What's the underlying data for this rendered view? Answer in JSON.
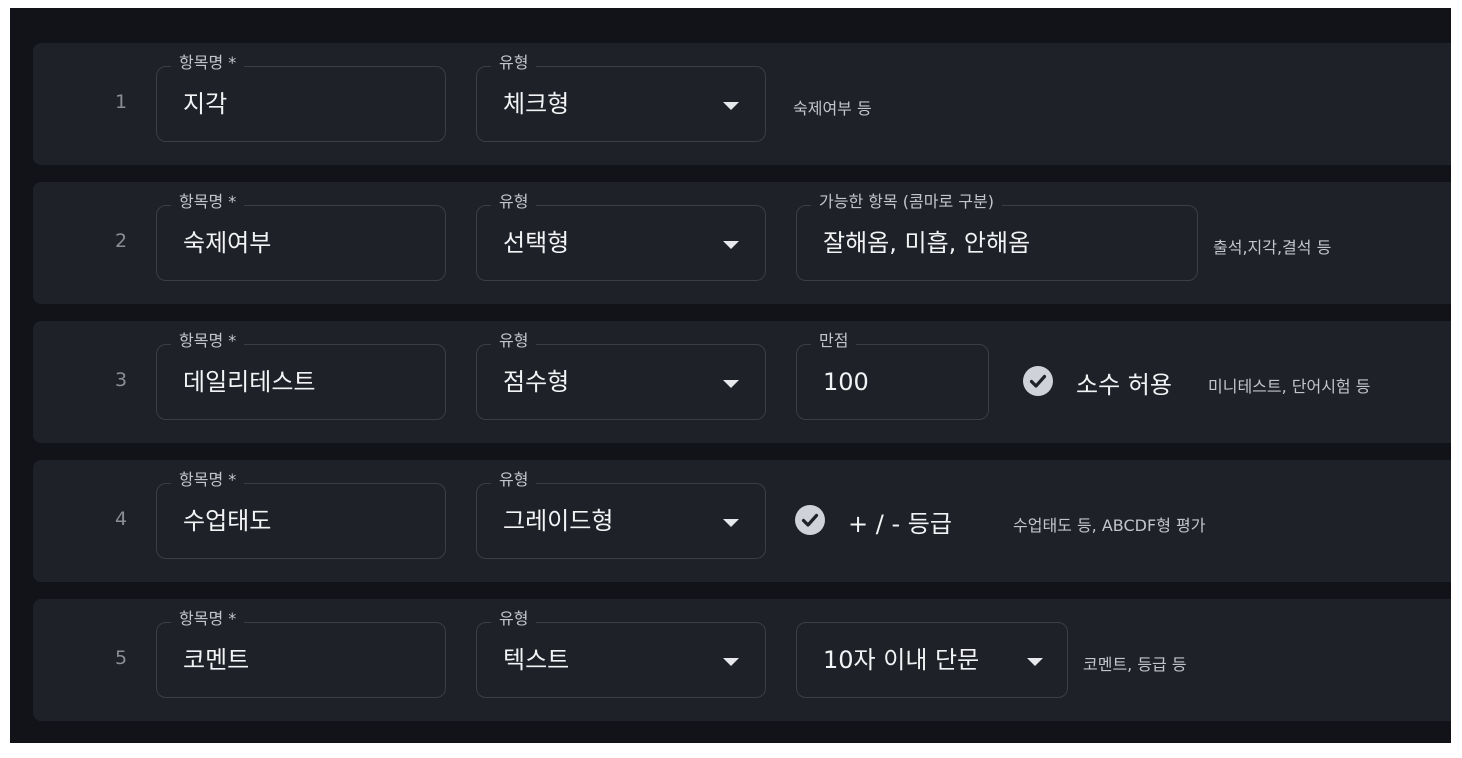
{
  "rows": [
    {
      "index": "1",
      "name_label": "항목명 *",
      "name_value": "지각",
      "type_label": "유형",
      "type_value": "체크형",
      "hint": "숙제여부 등"
    },
    {
      "index": "2",
      "name_label": "항목명 *",
      "name_value": "숙제여부",
      "type_label": "유형",
      "type_value": "선택형",
      "options_label": "가능한 항목 (콤마로 구분)",
      "options_value": "잘해옴, 미흡, 안해옴",
      "hint": "출석,지각,결석 등"
    },
    {
      "index": "3",
      "name_label": "항목명 *",
      "name_value": "데일리테스트",
      "type_label": "유형",
      "type_value": "점수형",
      "max_label": "만점",
      "max_value": "100",
      "decimal_label": "소수 허용",
      "decimal_checked": true,
      "hint": "미니테스트, 단어시험 등"
    },
    {
      "index": "4",
      "name_label": "항목명 *",
      "name_value": "수업태도",
      "type_label": "유형",
      "type_value": "그레이드형",
      "grade_label": "+ / - 등급",
      "grade_checked": true,
      "hint": "수업태도 등, ABCDF형 평가"
    },
    {
      "index": "5",
      "name_label": "항목명 *",
      "name_value": "코멘트",
      "type_label": "유형",
      "type_value": "텍스트",
      "length_value": "10자 이내 단문",
      "hint": "코멘트, 등급 등"
    }
  ],
  "icons": {
    "dropdown": "chevron-down-icon",
    "checkbox": "check-circle-icon"
  },
  "colors": {
    "page": "#111318",
    "row": "#1f2128",
    "border": "#3b3e46",
    "text": "#f2f3f5",
    "muted": "#c3c5cb",
    "check": "#cfd2d8"
  }
}
